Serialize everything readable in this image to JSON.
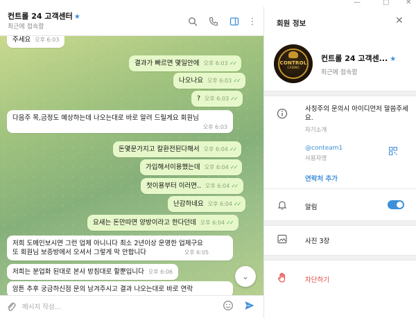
{
  "chat": {
    "title": "컨트롤 24 고객센터",
    "status": "최근에 접속함",
    "messages": [
      {
        "dir": "in",
        "text": "주세요",
        "time": "오후 6:03"
      },
      {
        "dir": "out",
        "text": "결과가 빠르면 몇일안에",
        "time": "오후 6:03"
      },
      {
        "dir": "out",
        "text": "나오나요",
        "time": "오후 6:03"
      },
      {
        "dir": "out",
        "text": "?",
        "time": "오후 6:03"
      },
      {
        "dir": "in",
        "text": "다음주 목,금정도 예상하는데 나오는대로 바로 알려 드릴게요 회원님",
        "time": "오후 6:03"
      },
      {
        "dir": "out",
        "text": "돈몇문가지고 칼환전된다해서",
        "time": "오후 6:04"
      },
      {
        "dir": "out",
        "text": "가입해서이용했는데",
        "time": "오후 6:04"
      },
      {
        "dir": "out",
        "text": "첫이용부터 이러면..",
        "time": "오후 6:04"
      },
      {
        "dir": "out",
        "text": "난감하네요",
        "time": "오후 6:04"
      },
      {
        "dir": "out",
        "text": "요새는 돈만따면 양방이라고 한다던데",
        "time": "오후 6:04"
      },
      {
        "dir": "in",
        "text_line1": "저희 도메인보시면 그런 업체 아니니다 최소 2년이상 운영한 업체구요",
        "text_line2": "또 회원님 보증방에서 오셔서 그렇게 막 안합니다",
        "time": "오후 6:05"
      },
      {
        "dir": "in",
        "text": "저희는 분업화 된대로 본사 방침대로 할뿐입니다",
        "time": "오후 6:06"
      },
      {
        "dir": "in",
        "text": "암튼 추후 궁금하신점 문의 남겨주시고 결과 나오는대로 바로 연락"
      }
    ],
    "composer_placeholder": "메시지 작성..."
  },
  "info_panel": {
    "title": "회원 정보",
    "name": "컨트롤 24 고객센...",
    "status": "최근에 접속함",
    "avatar_text": "CONTROL",
    "avatar_subtext": "CASINO",
    "bio": "사칭주의 문의시 아이디먼저 말씀주세요.",
    "bio_label": "자기소개",
    "username": "@conteam1",
    "username_label": "사용자명",
    "add_contact": "연락처 추가",
    "notifications_label": "알림",
    "notifications_on": true,
    "photos_label": "사진 3장",
    "block_label": "차단하기"
  },
  "colors": {
    "accent": "#3d8fd9",
    "danger": "#e0443c",
    "outgoing_bubble": "#e6f8c9"
  },
  "icons": {
    "search": "search-icon",
    "call": "phone-icon",
    "sidebar": "sidebar-toggle-icon",
    "more": "more-vertical-icon",
    "close": "close-icon",
    "info": "info-icon",
    "qr": "qr-code-icon",
    "bell": "bell-icon",
    "photo": "photo-icon",
    "block": "hand-stop-icon",
    "attach": "paperclip-icon",
    "emoji": "emoji-icon",
    "send": "send-icon",
    "scroll_down": "chevron-down-icon"
  }
}
